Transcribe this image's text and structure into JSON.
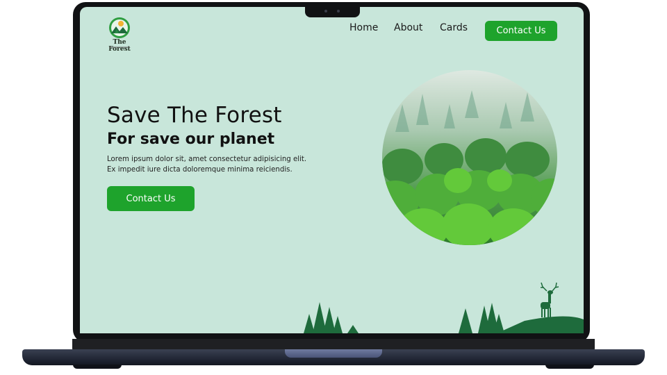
{
  "nav": {
    "logo_text": "The Forest",
    "links": [
      "Home",
      "About",
      "Cards"
    ],
    "contact_label": "Contact Us"
  },
  "hero": {
    "title": "Save The Forest",
    "subtitle": "For save our planet",
    "text": "Lorem ipsum dolor sit, amet consectetur adipisicing elit. Ex impedit iure dicta doloremque minima reiciendis.",
    "contact_label": "Contact Us"
  },
  "colors": {
    "page_bg": "#c8e6da",
    "accent": "#1ea32c",
    "tree_dark": "#1e6b3c",
    "frame": "#111214"
  },
  "icons": {
    "logo": "forest-logo-icon",
    "forest_image": "forest-photo",
    "deer": "deer-icon",
    "trees": "pine-tree-icon"
  }
}
